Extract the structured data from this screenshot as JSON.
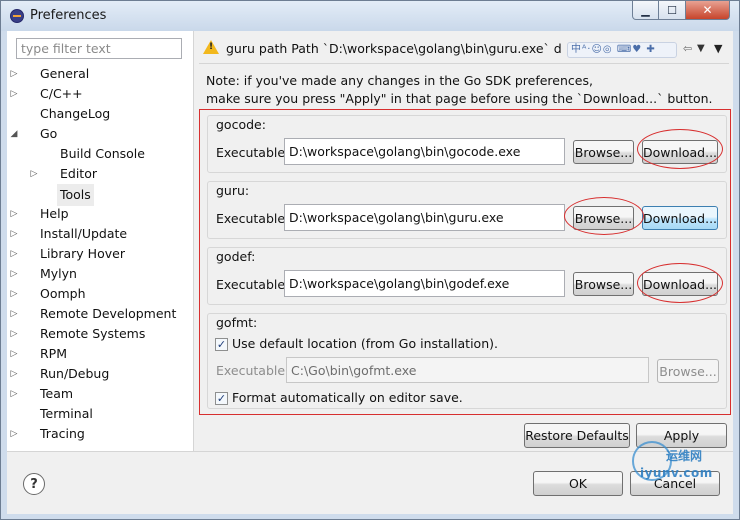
{
  "window": {
    "title": "Preferences",
    "minimize_glyph": "▁",
    "maximize_glyph": "☐",
    "close_glyph": "✕"
  },
  "filter": {
    "placeholder": "type filter text"
  },
  "tree": {
    "items": [
      {
        "label": "General",
        "expanded": false
      },
      {
        "label": "C/C++",
        "expanded": false
      },
      {
        "label": "ChangeLog"
      },
      {
        "label": "Go",
        "expanded": true
      },
      {
        "label": "Build Console"
      },
      {
        "label": "Editor",
        "expanded": false
      },
      {
        "label": "Tools",
        "selected": true
      },
      {
        "label": "Help",
        "expanded": false
      },
      {
        "label": "Install/Update",
        "expanded": false
      },
      {
        "label": "Library Hover",
        "expanded": false
      },
      {
        "label": "Mylyn",
        "expanded": false
      },
      {
        "label": "Oomph",
        "expanded": false
      },
      {
        "label": "Remote Development",
        "expanded": false
      },
      {
        "label": "Remote Systems",
        "expanded": false
      },
      {
        "label": "RPM",
        "expanded": false
      },
      {
        "label": "Run/Debug",
        "expanded": false
      },
      {
        "label": "Team",
        "expanded": false
      },
      {
        "label": "Terminal"
      },
      {
        "label": "Tracing",
        "expanded": false
      }
    ]
  },
  "header": {
    "message": "guru path Path `D:\\workspace\\golang\\bin\\guru.exe` does not exist.",
    "ime_toolbar": "中ᴬ·☺◎ ⌨♥ ✚",
    "back_glyph": "⇦",
    "menu_glyph": "▼",
    "dropdown_glyph": "▼"
  },
  "note": {
    "line1": "Note: if you've made any changes in the Go SDK preferences,",
    "line2": "make sure you press \"Apply\" in that page before using the `Download...` button."
  },
  "groups": {
    "gocode": {
      "title": "gocode:",
      "exe_label": "Executable:",
      "value": "D:\\workspace\\golang\\bin\\gocode.exe",
      "browse": "Browse...",
      "download": "Download..."
    },
    "guru": {
      "title": "guru:",
      "exe_label": "Executable:",
      "value": "D:\\workspace\\golang\\bin\\guru.exe",
      "browse": "Browse...",
      "download": "Download..."
    },
    "godef": {
      "title": "godef:",
      "exe_label": "Executable:",
      "value": "D:\\workspace\\golang\\bin\\godef.exe",
      "browse": "Browse...",
      "download": "Download..."
    },
    "gofmt": {
      "title": "gofmt:",
      "use_default_label": "Use default location (from Go installation).",
      "use_default_checked": true,
      "exe_label": "Executable:",
      "value": "C:\\Go\\bin\\gofmt.exe",
      "browse": "Browse...",
      "format_label": "Format automatically on editor save.",
      "format_checked": true
    }
  },
  "buttons": {
    "restore_defaults": "Restore Defaults",
    "apply": "Apply",
    "ok": "OK",
    "cancel": "Cancel",
    "help": "?"
  },
  "checkmark": "✓",
  "watermark": {
    "line1": "运维网",
    "line2": "iyunv.com"
  },
  "colors": {
    "annotation_red": "#d72f2f",
    "warning": "#f2b81d",
    "titlebar": "#cfdcec"
  },
  "icons": {
    "warning": "warning-triangle-icon",
    "help": "question-mark-icon",
    "app": "eclipse-icon"
  }
}
